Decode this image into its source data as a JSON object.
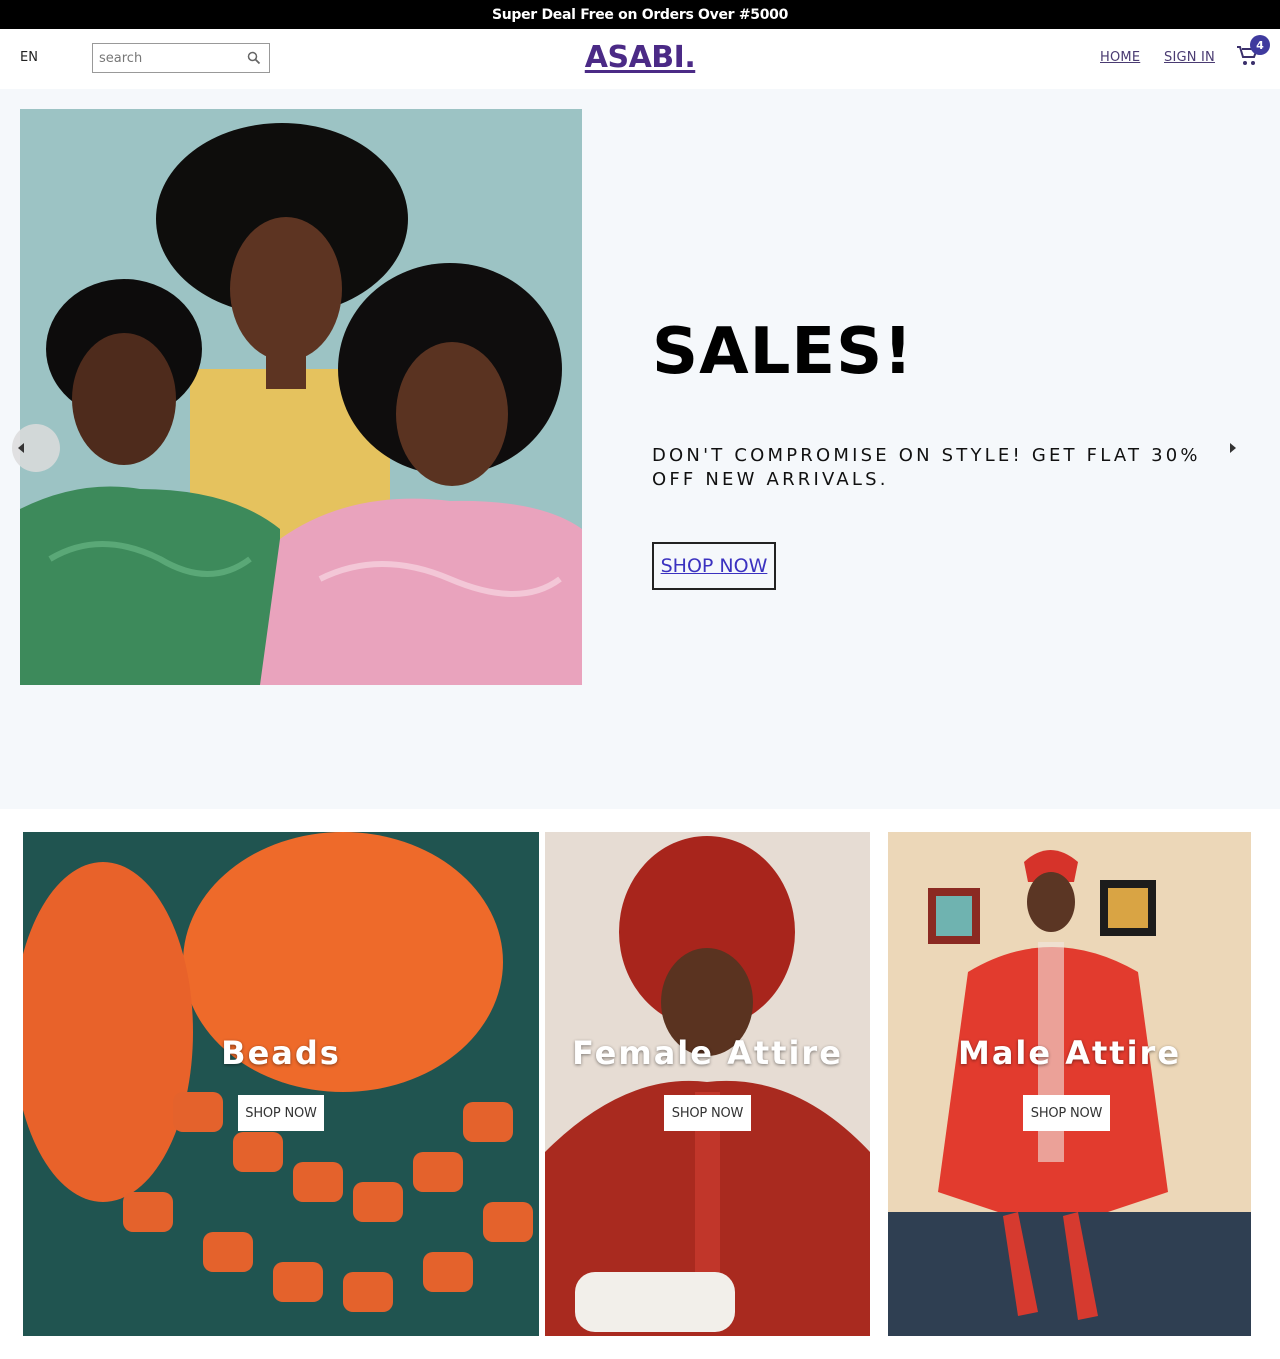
{
  "announcement": "Super Deal Free on Orders Over #5000",
  "nav": {
    "language": "EN",
    "search_placeholder": "search",
    "logo": "ASABI.",
    "links": [
      "HOME",
      "SIGN IN"
    ],
    "cart_count": "4"
  },
  "hero": {
    "title": "SALES!",
    "description": "DON'T COMPROMISE ON STYLE! GET FLAT 30% OFF NEW ARRIVALS.",
    "button": "SHOP NOW"
  },
  "categories": [
    {
      "title": "Beads",
      "button": "SHOP NOW"
    },
    {
      "title": "Female Attire",
      "button": "SHOP NOW"
    },
    {
      "title": "Male Attire",
      "button": "SHOP NOW"
    }
  ],
  "colors": {
    "logo": "#4b2a86",
    "badge": "#3f3a9e",
    "hero_bg": "#f5f8fb",
    "link": "#3b32c0"
  },
  "icons": [
    "search-icon",
    "cart-icon",
    "chevron-left-icon",
    "chevron-right-icon"
  ]
}
